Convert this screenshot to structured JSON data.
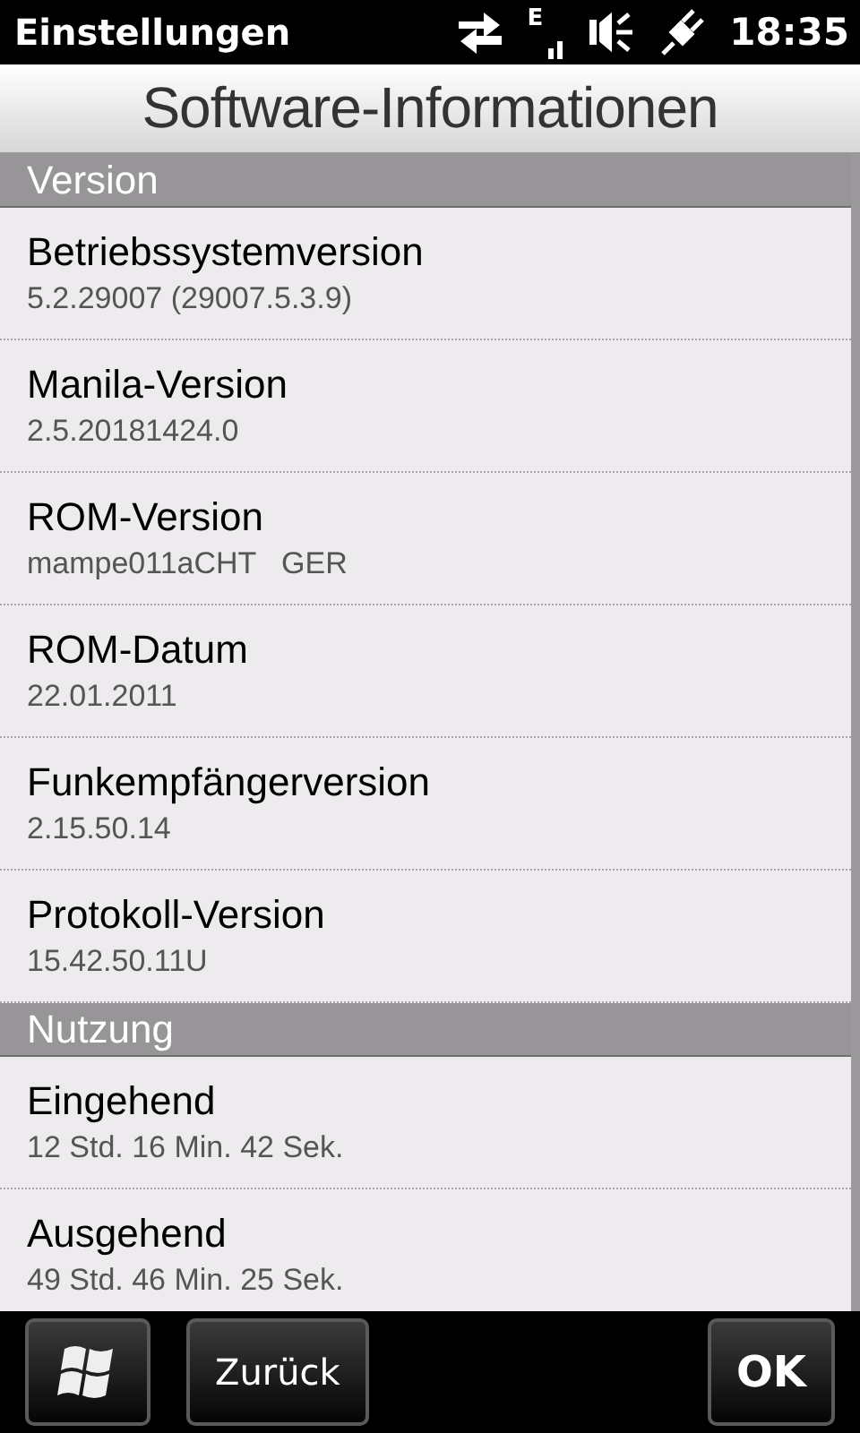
{
  "status_bar": {
    "app_title": "Einstellungen",
    "network_type": "E",
    "time": "18:35"
  },
  "header": {
    "title": "Software-Informationen"
  },
  "sections": [
    {
      "heading": "Version",
      "items": [
        {
          "label": "Betriebssystemversion",
          "value": "5.2.29007 (29007.5.3.9)"
        },
        {
          "label": "Manila-Version",
          "value": "2.5.20181424.0"
        },
        {
          "label": "ROM-Version",
          "value": "mampe011aCHT   GER"
        },
        {
          "label": "ROM-Datum",
          "value": "22.01.2011"
        },
        {
          "label": "Funkempfängerversion",
          "value": "2.15.50.14"
        },
        {
          "label": "Protokoll-Version",
          "value": "15.42.50.11U"
        }
      ]
    },
    {
      "heading": "Nutzung",
      "items": [
        {
          "label": "Eingehend",
          "value": "12 Std. 16 Min. 42 Sek."
        },
        {
          "label": "Ausgehend",
          "value": "49 Std. 46 Min. 25 Sek."
        }
      ]
    }
  ],
  "bottom_bar": {
    "back_button": "Zurück",
    "ok_button": "OK"
  }
}
